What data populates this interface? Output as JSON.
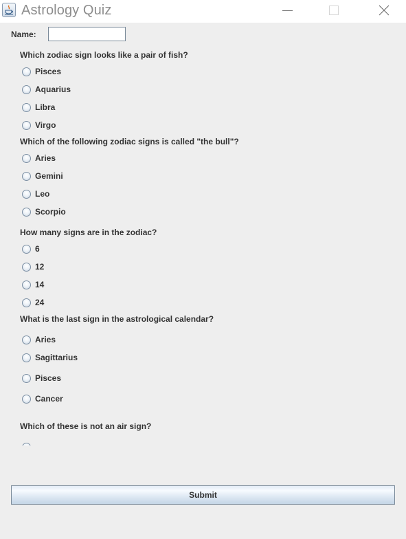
{
  "window": {
    "title": "Astrology Quiz",
    "icon": "java-cup-icon",
    "controls": {
      "minimize": "minimize-icon",
      "maximize": "maximize-icon",
      "close": "close-icon"
    }
  },
  "form": {
    "name_label": "Name:",
    "name_value": "",
    "name_placeholder": ""
  },
  "questions": [
    {
      "text": "Which zodiac sign looks like a pair of fish?",
      "options": [
        "Pisces",
        "Aquarius",
        "Libra",
        "Virgo"
      ]
    },
    {
      "text": "Which of the following zodiac signs is called \"the bull\"?",
      "options": [
        "Aries",
        "Gemini",
        "Leo",
        "Scorpio"
      ]
    },
    {
      "text": "How many signs are in the zodiac?",
      "options": [
        "6",
        "12",
        "14",
        "24"
      ]
    },
    {
      "text": "What is the last sign in the astrological calendar?",
      "options": [
        "Aries",
        "Sagittarius",
        "Pisces",
        "Cancer"
      ]
    },
    {
      "text": "Which of these is not an air sign?",
      "options": [
        ""
      ]
    }
  ],
  "submit_label": "Submit"
}
